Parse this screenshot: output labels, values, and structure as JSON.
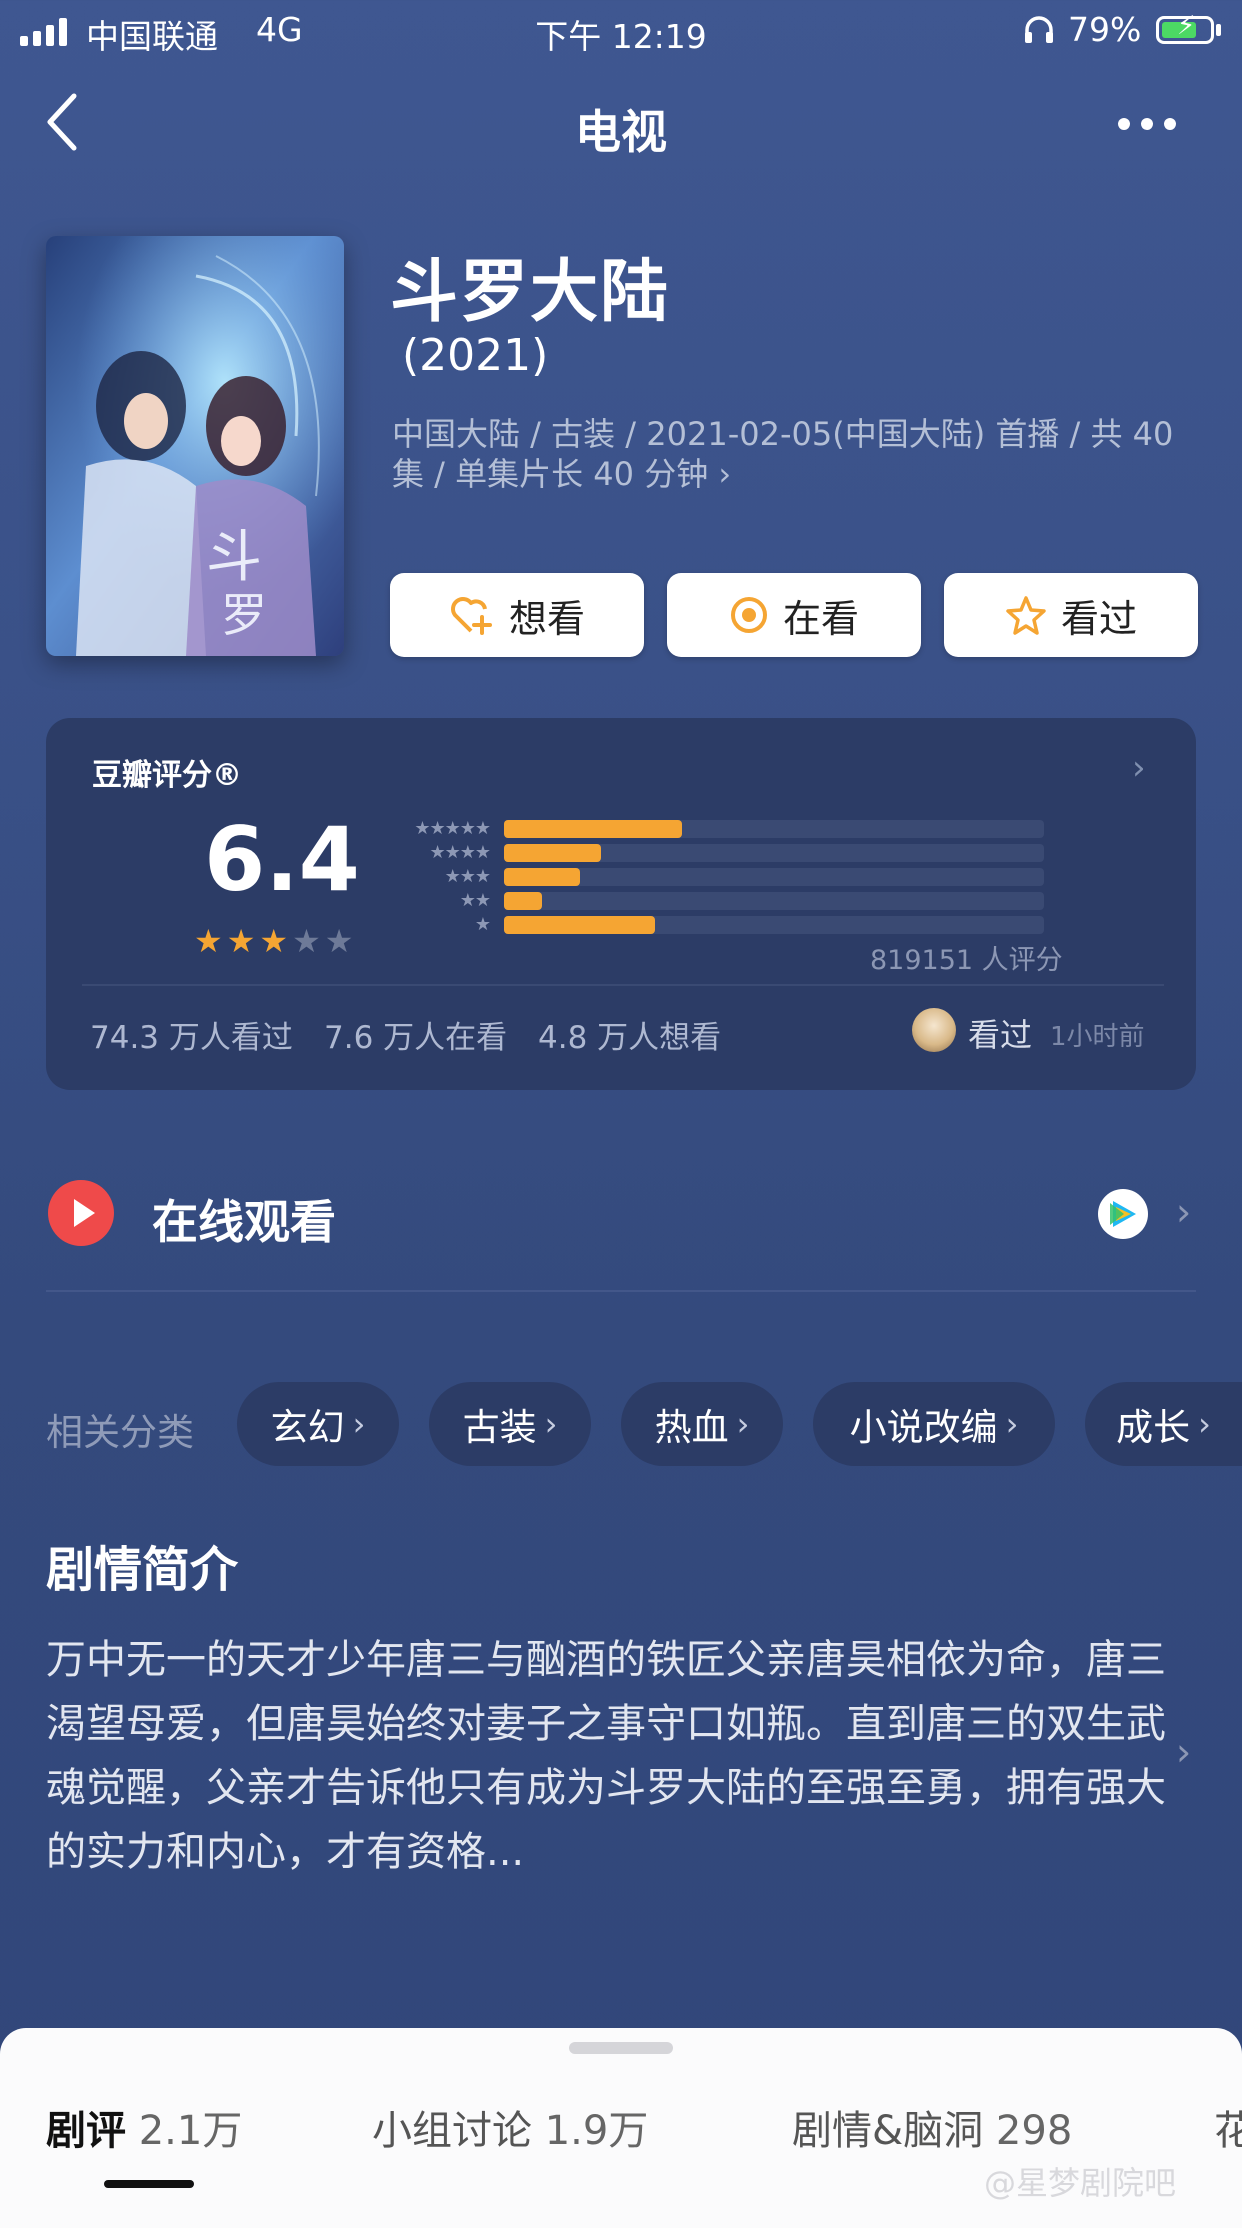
{
  "status_bar": {
    "carrier": "中国联通",
    "network": "4G",
    "time": "下午 12:19",
    "battery": "79%"
  },
  "nav": {
    "title": "电视"
  },
  "show": {
    "title": "斗罗大陆",
    "year": "(2021)",
    "meta": "中国大陆 / 古装 / 2021-02-05(中国大陆) 首播 / 共 40 集 / 单集片长 40 分钟 ›"
  },
  "actions": {
    "want": "想看",
    "watching": "在看",
    "watched": "看过"
  },
  "rating": {
    "label": "豆瓣评分®",
    "score": "6.4",
    "stars_filled": 3,
    "stars_total": 5,
    "distribution": [
      {
        "stars": "★★★★★",
        "fraction": 0.33
      },
      {
        "stars": "★★★★",
        "fraction": 0.18
      },
      {
        "stars": "★★★",
        "fraction": 0.14
      },
      {
        "stars": "★★",
        "fraction": 0.07
      },
      {
        "stars": "★",
        "fraction": 0.28
      }
    ],
    "raters": "819151 人评分",
    "stats": {
      "watched": "74.3 万人看过",
      "watching": "7.6 万人在看",
      "want": "4.8 万人想看"
    },
    "user_status": "看过",
    "user_time": "1小时前"
  },
  "online": {
    "title": "在线观看"
  },
  "tags": {
    "label": "相关分类",
    "items": [
      "玄幻",
      "古装",
      "热血",
      "小说改编",
      "成长"
    ]
  },
  "synopsis": {
    "title": "剧情简介",
    "text": "万中无一的天才少年唐三与酗酒的铁匠父亲唐昊相依为命，唐三渴望母爱，但唐昊始终对妻子之事守口如瓶。直到唐三的双生武魂觉醒，父亲才告诉他只有成为斗罗大陆的至强至勇，拥有强大的实力和内心，才有资格..."
  },
  "bottom_tabs": [
    {
      "label": "剧评",
      "count": "2.1万"
    },
    {
      "label": "小组讨论",
      "count": "1.9万"
    },
    {
      "label": "剧情&脑洞",
      "count": "298"
    },
    {
      "label": "花",
      "count": ""
    }
  ],
  "watermark": "@星梦剧院吧",
  "colors": {
    "accent_orange": "#f5a533",
    "play_red": "#ef4a4a",
    "bg_top": "#3f5791",
    "card_bg": "#2c3c66"
  }
}
